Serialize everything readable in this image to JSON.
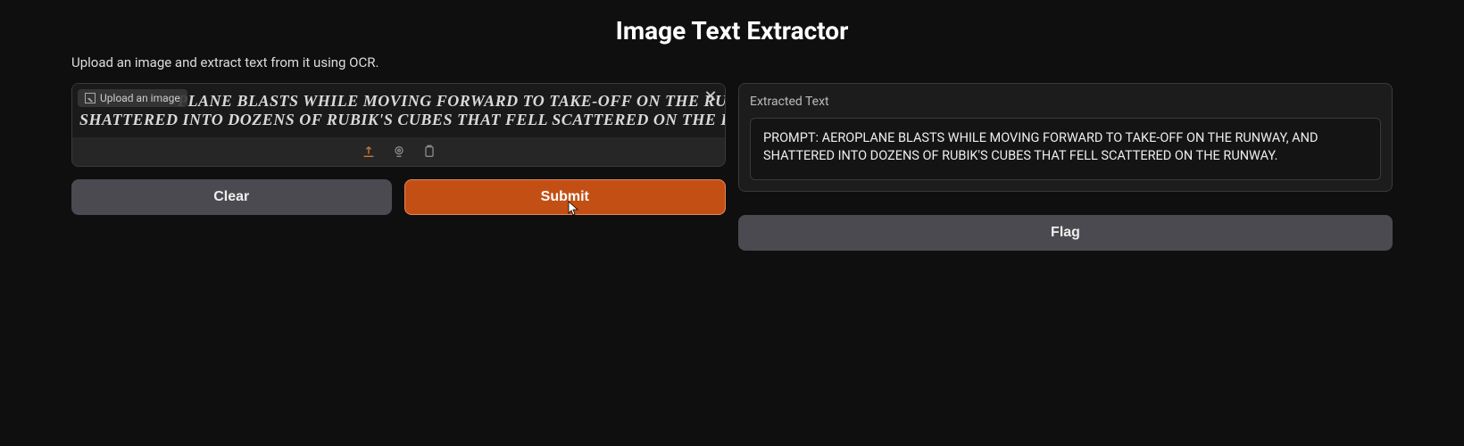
{
  "title": "Image Text Extractor",
  "subtitle": "Upload an image and extract text from it using OCR.",
  "upload": {
    "label": "Upload an image",
    "preview_line1": "PLANE BLASTS WHILE MOVING FORWARD TO TAKE-OFF ON THE RUNWAY, ANI",
    "preview_line2": "SHATTERED INTO DOZENS OF RUBIK'S CUBES THAT FELL SCATTERED ON THE RUNWAY."
  },
  "buttons": {
    "clear": "Clear",
    "submit": "Submit",
    "flag": "Flag"
  },
  "output": {
    "label": "Extracted Text",
    "text": "PROMPT: AEROPLANE BLASTS WHILE MOVING FORWARD TO TAKE-OFF ON THE RUNWAY, AND SHATTERED INTO DOZENS OF RUBIK'S CUBES THAT FELL SCATTERED ON THE RUNWAY."
  }
}
